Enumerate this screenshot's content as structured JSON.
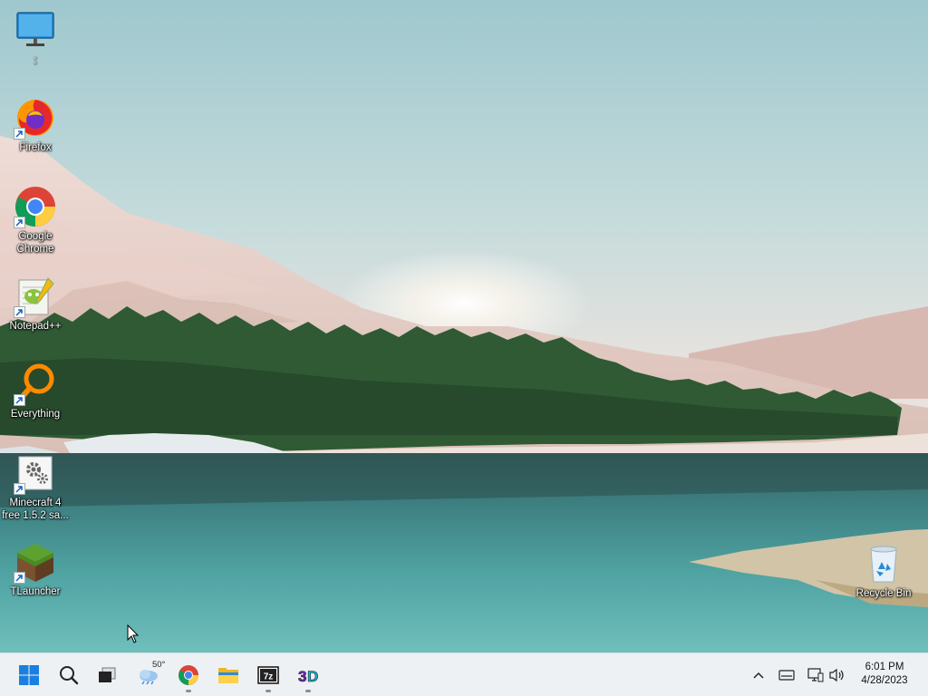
{
  "desktop": {
    "icons": [
      {
        "id": "this-pc",
        "label": ":"
      },
      {
        "id": "firefox",
        "label": "Firefox"
      },
      {
        "id": "chrome",
        "label": "Google Chrome"
      },
      {
        "id": "notepadpp",
        "label": "Notepad++"
      },
      {
        "id": "everything",
        "label": "Everything"
      },
      {
        "id": "minecraft",
        "label": "Minecraft 4 free 1.5.2 sa..."
      },
      {
        "id": "tlauncher",
        "label": "TLauncher"
      },
      {
        "id": "recycle",
        "label": "Recycle Bin"
      }
    ]
  },
  "taskbar": {
    "weather": {
      "temp": "50°"
    },
    "pinned": [
      "start-icon",
      "search-icon",
      "task-view-icon",
      "weather-icon",
      "chrome-icon",
      "file-explorer-icon",
      "7zip-icon",
      "3d-app-icon"
    ],
    "clock": {
      "time": "6:01 PM",
      "date": "4/28/2023"
    }
  },
  "colors": {
    "taskbar_bg": "#eef1f4",
    "accent": "#0a64c8",
    "sky_top": "#a8cdd2",
    "lake": "#3f8e8f"
  }
}
